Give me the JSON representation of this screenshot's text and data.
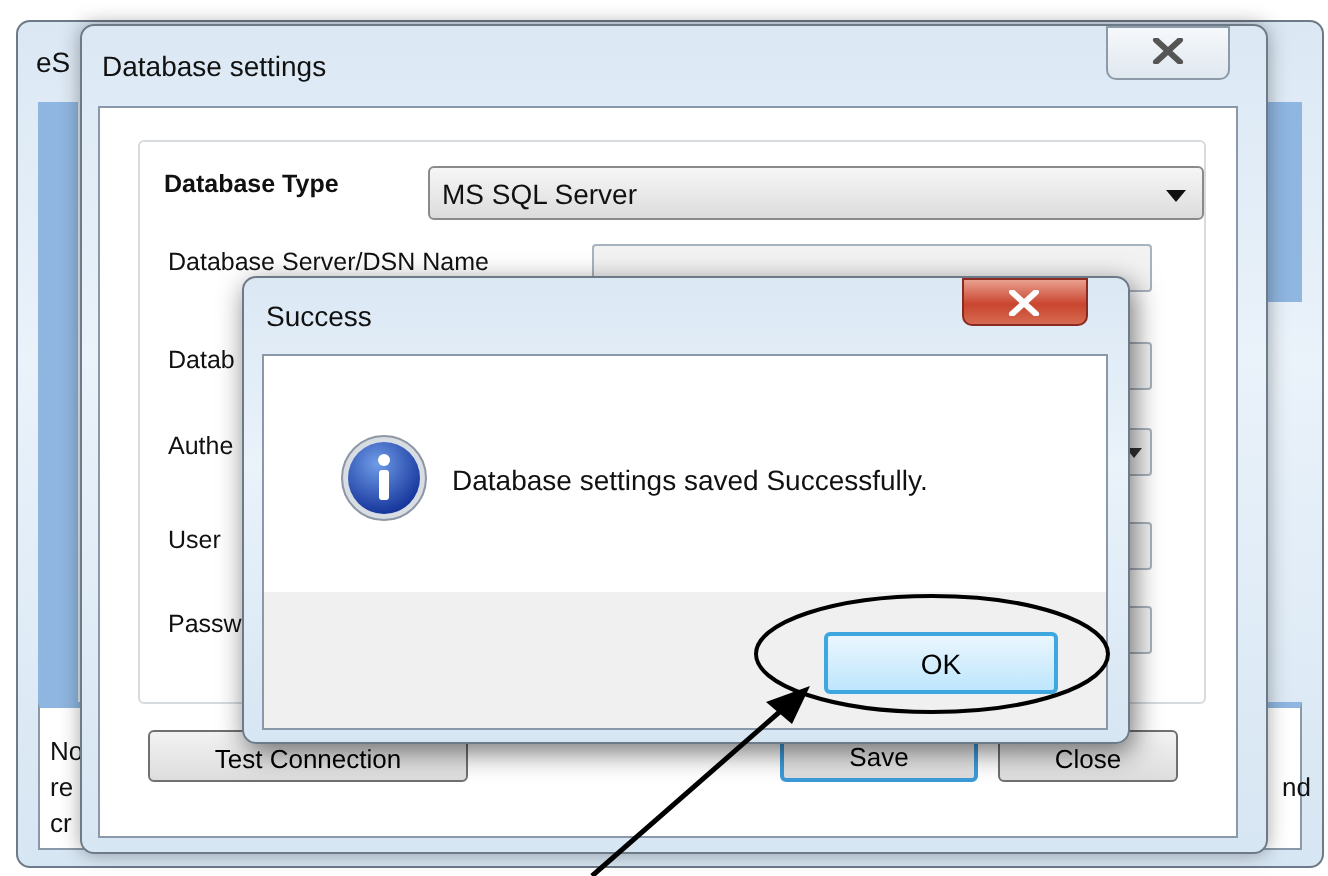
{
  "back_window": {
    "title": "eS",
    "text_left": [
      "No",
      "re",
      "cr"
    ],
    "text_right": "nd"
  },
  "settings_window": {
    "title": "Database settings",
    "database_type": {
      "label": "Database Type",
      "value": "MS SQL Server"
    },
    "fields": [
      {
        "label": "Database Server/DSN Name",
        "kind": "text"
      },
      {
        "label": "Datab",
        "kind": "text"
      },
      {
        "label": "Authe",
        "kind": "dropdown"
      },
      {
        "label": "User",
        "kind": "text"
      },
      {
        "label": "Passw",
        "kind": "text"
      }
    ],
    "buttons": [
      {
        "label": "Test Connection",
        "default": false
      },
      {
        "label": "Save",
        "default": true
      },
      {
        "label": "Close",
        "default": false
      }
    ]
  },
  "success_dialog": {
    "title": "Success",
    "message": "Database settings saved Successfully.",
    "button": "OK"
  }
}
